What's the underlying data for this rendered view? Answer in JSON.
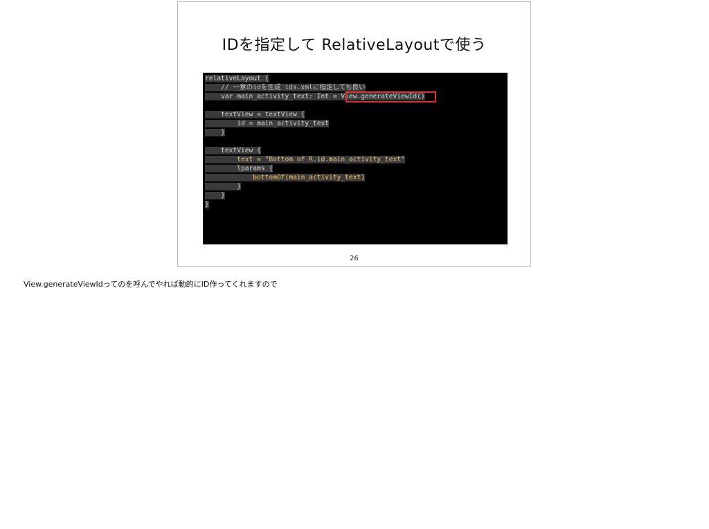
{
  "slide": {
    "title": "IDを指定して RelativeLayoutで使う",
    "page_number": "26"
  },
  "code_lines": [
    "relativeLayout {",
    "    // 一意のidを生成 ids.xmlに指定しても良い",
    "    var main_activity_text: Int = View.generateViewId()",
    "",
    "    textView = textView {",
    "        id = main_activity_text",
    "    }",
    "",
    "    textView {",
    "        text = \"Bottom of R.id.main_activity_text\"",
    "        lparams {",
    "            bottomOf(main_activity_text)",
    "        }",
    "    }",
    "}"
  ],
  "highlight_text": "View.generateViewId()",
  "notes": "View.generateViewIdってのを呼んでやれば動的にID作ってくれますので",
  "colors": {
    "keyword": "#cc7832",
    "type": "#6fb3d2",
    "function": "#ffc66d",
    "highlight_border": "#e03030"
  }
}
